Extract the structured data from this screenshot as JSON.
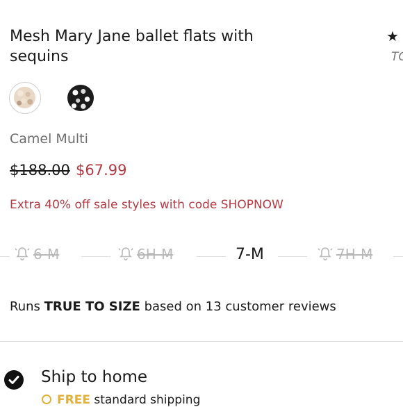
{
  "product": {
    "title": "Mesh Mary Jane ballet flats with sequins",
    "rating_glyph": "★",
    "brand_link": "TC",
    "selected_color": "Camel Multi",
    "swatches": [
      {
        "name": "Camel Multi",
        "selected": true
      },
      {
        "name": "Black Multi",
        "selected": false
      }
    ],
    "original_price": "$188.00",
    "sale_price": "$67.99",
    "promo": "Extra 40% off sale styles with code SHOPNOW"
  },
  "sizes": [
    {
      "label": "6-M",
      "available": false,
      "icon": "bell-icon"
    },
    {
      "label": "6H-M",
      "available": false,
      "icon": "bell-icon"
    },
    {
      "label": "7-M",
      "available": true
    },
    {
      "label": "7H-M",
      "available": false,
      "icon": "bell-icon"
    }
  ],
  "fit": {
    "prefix": "Runs",
    "emphasis": "TRUE TO SIZE",
    "suffix": "based on 13 customer reviews"
  },
  "shipping": {
    "title": "Ship to home",
    "free_label": "FREE",
    "sub_label": "standard shipping"
  },
  "colors": {
    "sale": "#b23a43",
    "muted": "#6e6e6e",
    "unavailable": "#b9b9b9",
    "free": "#e0b03a"
  }
}
